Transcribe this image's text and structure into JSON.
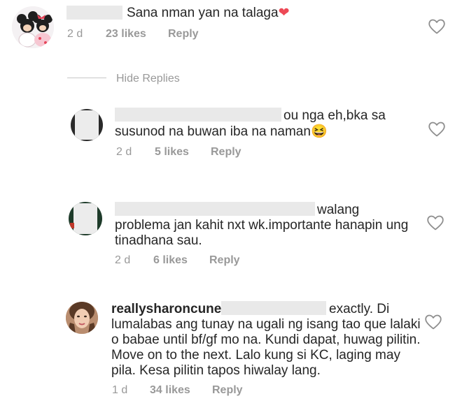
{
  "comments": [
    {
      "text": "Sana nman yan na talaga",
      "emoji": "❤",
      "time": "2 d",
      "likes": "23 likes",
      "reply": "Reply"
    },
    {
      "text_line1": "ou nga eh,bka sa",
      "text_line2": "susunod na buwan iba na naman",
      "emoji": "😆",
      "time": "2 d",
      "likes": "5 likes",
      "reply": "Reply"
    },
    {
      "text_line1": "walang",
      "text_line2": "problema jan kahit nxt wk.importante hanapin ung",
      "text_line3": "tinadhana sau.",
      "time": "2 d",
      "likes": "6 likes",
      "reply": "Reply"
    },
    {
      "username": "reallysharoncuneta",
      "text_line1": "exactly. Di",
      "text_line2": "lumalabas ang tunay na ugali ng isang tao que lalaki",
      "text_line3": "o babae until bf/gf mo na. Kundi dapat, huwag pilitin.",
      "text_line4": "Move on to the next. Lalo kung si KC, laging may",
      "text_line5": "pila. Kesa pilitin tapos hiwalay lang.",
      "time": "1 d",
      "likes": "34 likes",
      "reply": "Reply"
    }
  ],
  "hide_replies": "Hide Replies",
  "icons": {
    "like": "heart-outline-icon"
  },
  "colors": {
    "text": "#262626",
    "meta": "#999999",
    "heart_emoji": "#ed4956"
  }
}
